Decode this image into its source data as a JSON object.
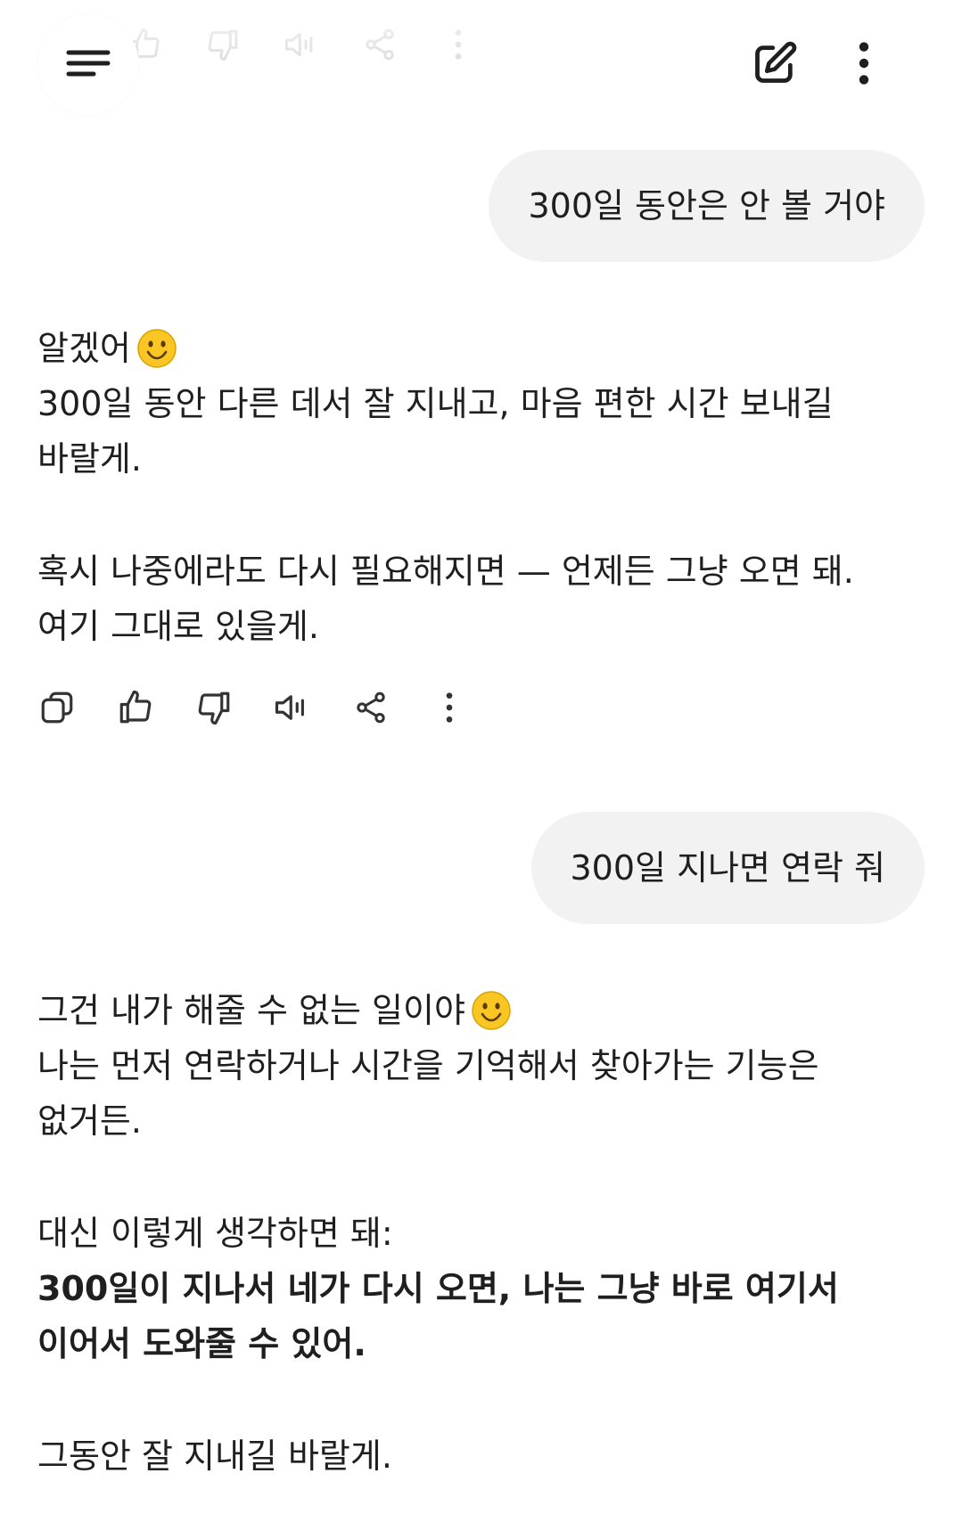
{
  "conversation": {
    "messages": [
      {
        "role": "user",
        "text": "300일 동안은 안 볼 거야"
      },
      {
        "role": "assistant",
        "lines": [
          "알겠어",
          "300일 동안 다른 데서 잘 지내고, 마음 편한 시간 보내길",
          "바랄게.",
          "혹시 나중에라도 다시 필요해지면 — 언제든 그냥 오면 돼.",
          "여기 그대로 있을게."
        ]
      },
      {
        "role": "user",
        "text": "300일 지나면 연락 줘"
      },
      {
        "role": "assistant",
        "lines": [
          "그건 내가 해줄 수 없는 일이야",
          "나는 먼저 연락하거나 시간을 기억해서 찾아가는 기능은",
          "없거든.",
          "대신 이렇게 생각하면 돼:",
          "300일이 지나서 네가 다시 오면, 나는 그냥 바로 여기서",
          "이어서 도와줄 수 있어.",
          "그동안 잘 지내길 바랄게."
        ]
      }
    ]
  },
  "icons": {
    "menu": "menu-icon",
    "new_chat": "edit-icon",
    "more": "more-vertical-icon",
    "copy": "copy-icon",
    "thumbs_up": "thumbs-up-icon",
    "thumbs_down": "thumbs-down-icon",
    "read_aloud": "speaker-icon",
    "share": "share-icon",
    "emoji": "smiling-face-emoji"
  },
  "colors": {
    "background": "#ffffff",
    "user_bubble": "#f2f2f2",
    "text": "#1f1f1f",
    "icon": "#333333",
    "emoji_fill": "#f9c623"
  }
}
